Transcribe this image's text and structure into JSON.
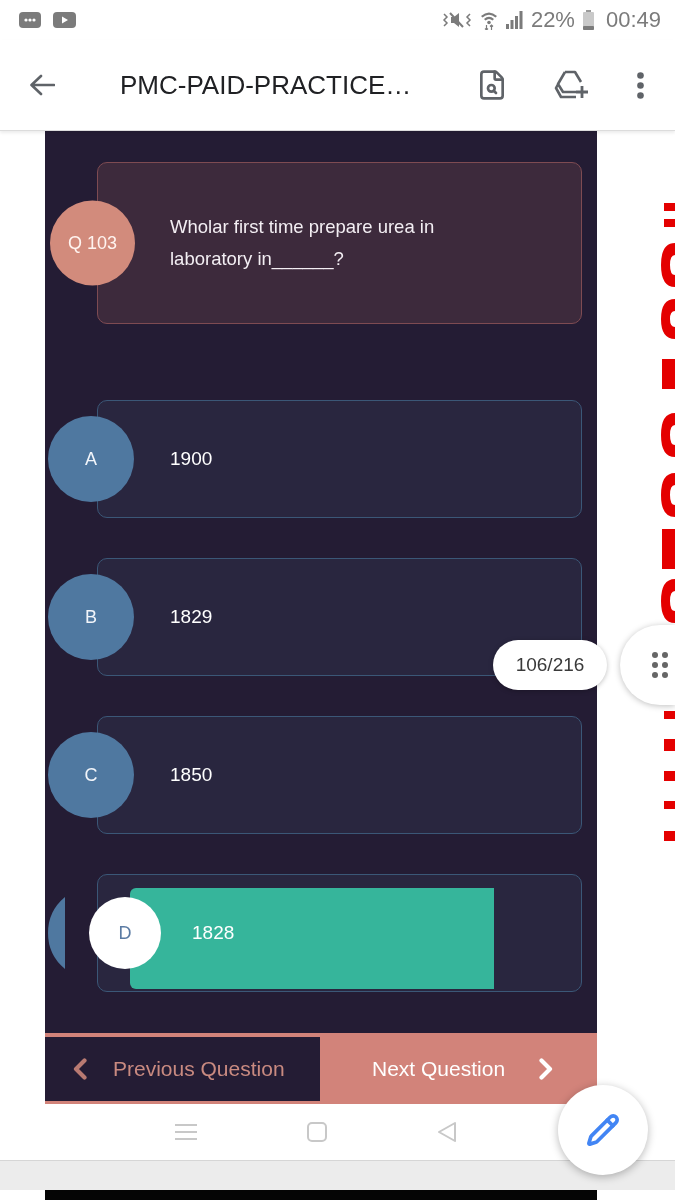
{
  "status_bar": {
    "battery": "22%",
    "time": "00:49"
  },
  "app_bar": {
    "title": "PMC-PAID-PRACTICE…"
  },
  "question": {
    "number": "Q 103",
    "text": "Wholar first time prepare urea in laboratory in______?"
  },
  "options": [
    {
      "letter": "A",
      "text": "1900",
      "selected": false
    },
    {
      "letter": "B",
      "text": "1829",
      "selected": false
    },
    {
      "letter": "C",
      "text": "1850",
      "selected": false
    },
    {
      "letter": "D",
      "text": "1828",
      "selected": true
    }
  ],
  "navigation": {
    "previous": "Previous Question",
    "next": "Next Question"
  },
  "page_indicator": "106/216"
}
